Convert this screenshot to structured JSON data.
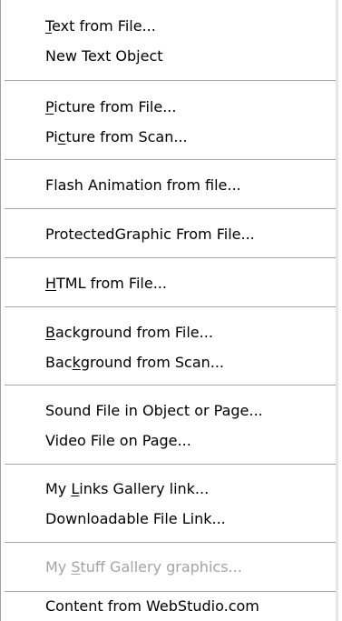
{
  "menu": {
    "groups": [
      {
        "items": [
          {
            "pre": "",
            "mn": "T",
            "post": "ext from File...",
            "enabled": true
          },
          {
            "pre": "New Text Object",
            "mn": "",
            "post": "",
            "enabled": true
          }
        ]
      },
      {
        "items": [
          {
            "pre": "",
            "mn": "P",
            "post": "icture from File...",
            "enabled": true
          },
          {
            "pre": "Pi",
            "mn": "c",
            "post": "ture from Scan...",
            "enabled": true
          }
        ]
      },
      {
        "items": [
          {
            "pre": "Flash Animation from file...",
            "mn": "",
            "post": "",
            "enabled": true
          }
        ]
      },
      {
        "items": [
          {
            "pre": "ProtectedGraphic From File...",
            "mn": "",
            "post": "",
            "enabled": true
          }
        ]
      },
      {
        "items": [
          {
            "pre": "",
            "mn": "H",
            "post": "TML from File...",
            "enabled": true
          }
        ]
      },
      {
        "items": [
          {
            "pre": "",
            "mn": "B",
            "post": "ackground from File...",
            "enabled": true
          },
          {
            "pre": "Bac",
            "mn": "k",
            "post": "ground from Scan...",
            "enabled": true
          }
        ]
      },
      {
        "items": [
          {
            "pre": "Sound File in Object or Page...",
            "mn": "",
            "post": "",
            "enabled": true
          },
          {
            "pre": "Video File on Page...",
            "mn": "",
            "post": "",
            "enabled": true
          }
        ]
      },
      {
        "items": [
          {
            "pre": "My ",
            "mn": "L",
            "post": "inks Gallery link...",
            "enabled": true
          },
          {
            "pre": "Downloadable File Link...",
            "mn": "",
            "post": "",
            "enabled": true
          }
        ]
      },
      {
        "items": [
          {
            "pre": "My ",
            "mn": "S",
            "post": "tuff Gallery graphics...",
            "enabled": false
          }
        ]
      },
      {
        "items": [
          {
            "pre": "Content from WebStudio.com",
            "mn": "",
            "post": "",
            "enabled": true
          }
        ]
      }
    ]
  }
}
